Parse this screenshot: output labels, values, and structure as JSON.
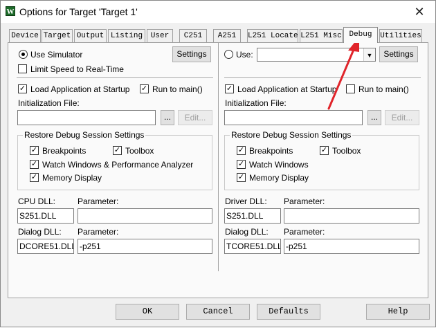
{
  "window": {
    "title": "Options for Target 'Target 1'",
    "app_icon_glyph": "W",
    "close_glyph": "✕"
  },
  "tabs": [
    {
      "label": "Device"
    },
    {
      "label": "Target"
    },
    {
      "label": "Output"
    },
    {
      "label": "Listing"
    },
    {
      "label": "User"
    },
    {
      "label": "C251"
    },
    {
      "label": "A251"
    },
    {
      "label": "L251 Locate"
    },
    {
      "label": "L251 Misc"
    },
    {
      "label": "Debug"
    },
    {
      "label": "Utilities"
    }
  ],
  "left": {
    "use_simulator": "Use Simulator",
    "settings": "Settings",
    "limit_speed": "Limit Speed to Real-Time",
    "load_app": "Load Application at Startup",
    "run_to_main": "Run to main()",
    "init_file_label": "Initialization File:",
    "init_file_value": "",
    "browse": "...",
    "edit": "Edit...",
    "restore_title": "Restore Debug Session Settings",
    "breakpoints": "Breakpoints",
    "toolbox": "Toolbox",
    "watch": "Watch Windows & Performance Analyzer",
    "memory": "Memory Display",
    "dll_label": "CPU DLL:",
    "dll_param_label": "Parameter:",
    "dll_value": "S251.DLL",
    "dll_param_value": "",
    "dialog_label": "Dialog DLL:",
    "dialog_param_label": "Parameter:",
    "dialog_value": "DCORE51.DLL",
    "dialog_param_value": "-p251"
  },
  "right": {
    "use": "Use:",
    "use_value": "",
    "settings": "Settings",
    "load_app": "Load Application at Startup",
    "run_to_main": "Run to main()",
    "init_file_label": "Initialization File:",
    "init_file_value": "",
    "browse": "...",
    "edit": "Edit...",
    "restore_title": "Restore Debug Session Settings",
    "breakpoints": "Breakpoints",
    "toolbox": "Toolbox",
    "watch": "Watch Windows",
    "memory": "Memory Display",
    "dll_label": "Driver DLL:",
    "dll_param_label": "Parameter:",
    "dll_value": "S251.DLL",
    "dll_param_value": "",
    "dialog_label": "Dialog DLL:",
    "dialog_param_label": "Parameter:",
    "dialog_value": "TCORE51.DLL",
    "dialog_param_value": "-p251"
  },
  "buttons": {
    "ok": "OK",
    "cancel": "Cancel",
    "defaults": "Defaults",
    "help": "Help"
  },
  "colors": {
    "annotation_arrow": "#e0242a"
  }
}
